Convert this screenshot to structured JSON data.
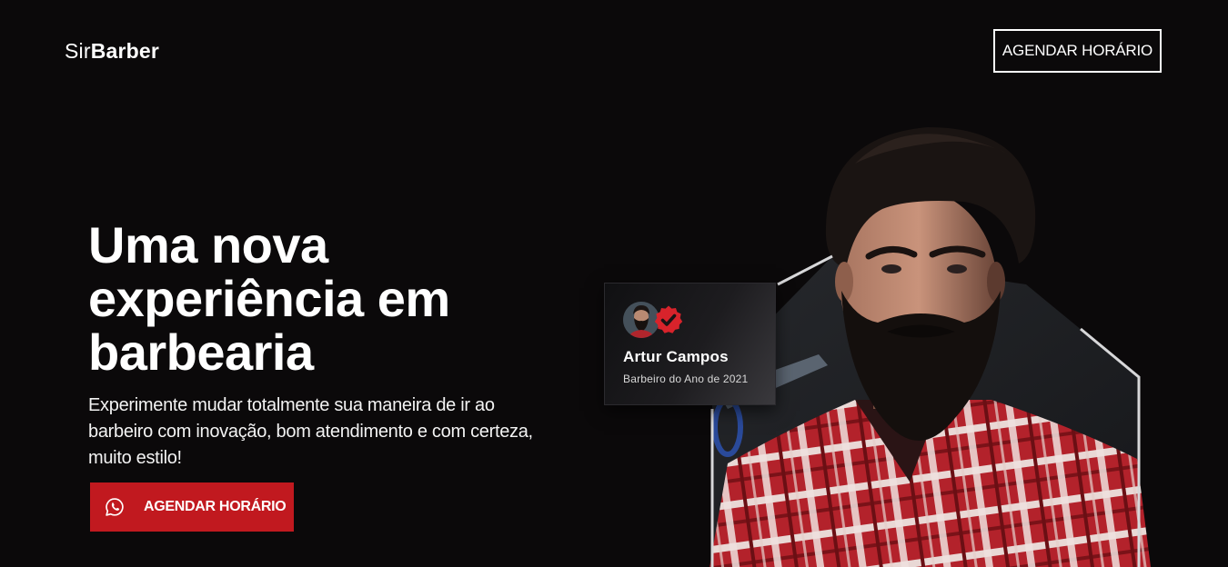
{
  "header": {
    "logo_light": "Sir",
    "logo_bold": "Barber",
    "cta_label": "AGENDAR HORÁRIO"
  },
  "hero": {
    "title_line1": "Uma nova",
    "title_line2": "experiência em",
    "title_line3": "barbearia",
    "subtitle": "Experimente mudar totalmente sua maneira de ir ao barbeiro com inovação, bom atendimento e com certeza, muito estilo!",
    "cta_label": "AGENDAR HORÁRIO",
    "cta_icon": "whatsapp-icon"
  },
  "badge": {
    "name": "Artur Campos",
    "role": "Barbeiro do Ano de 2021",
    "verified_icon": "verified-check-icon"
  },
  "colors": {
    "background": "#0b090a",
    "accent": "#c1191f",
    "text": "#ffffff"
  }
}
